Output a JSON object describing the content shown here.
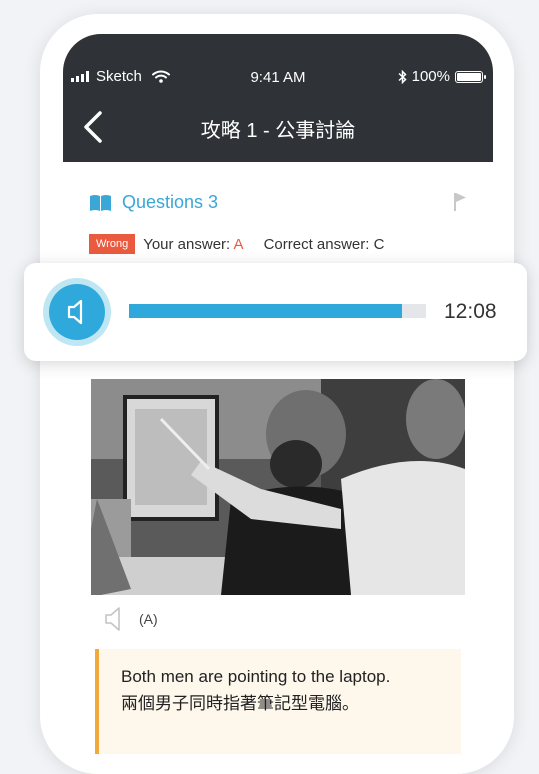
{
  "status_bar": {
    "carrier": "Sketch",
    "time": "9:41 AM",
    "battery": "100%"
  },
  "nav": {
    "title": "攻略 1 - 公事討論"
  },
  "question": {
    "label": "Questions 3",
    "result_badge": "Wrong",
    "your_answer_label": "Your answer:",
    "your_answer_value": "A",
    "correct_answer_label": "Correct answer:",
    "correct_answer_value": "C"
  },
  "audio_player": {
    "elapsed": "12:08",
    "progress": 0.92
  },
  "option": {
    "label": "(A)"
  },
  "answer_text": {
    "english": "Both men are pointing to the laptop.",
    "chinese": "兩個男子同時指著筆記型電腦。"
  },
  "colors": {
    "accent_blue": "#2fa9dc",
    "wrong_red": "#ea5a3f",
    "highlight_orange": "#f2a93b",
    "nav_dark": "#2f3236"
  },
  "icons": {
    "back": "chevron-left-icon",
    "book": "book-icon",
    "flag": "flag-icon",
    "speaker": "speaker-icon",
    "wifi": "wifi-icon",
    "bluetooth": "bluetooth-icon",
    "battery": "battery-icon",
    "signal": "signal-icon"
  }
}
